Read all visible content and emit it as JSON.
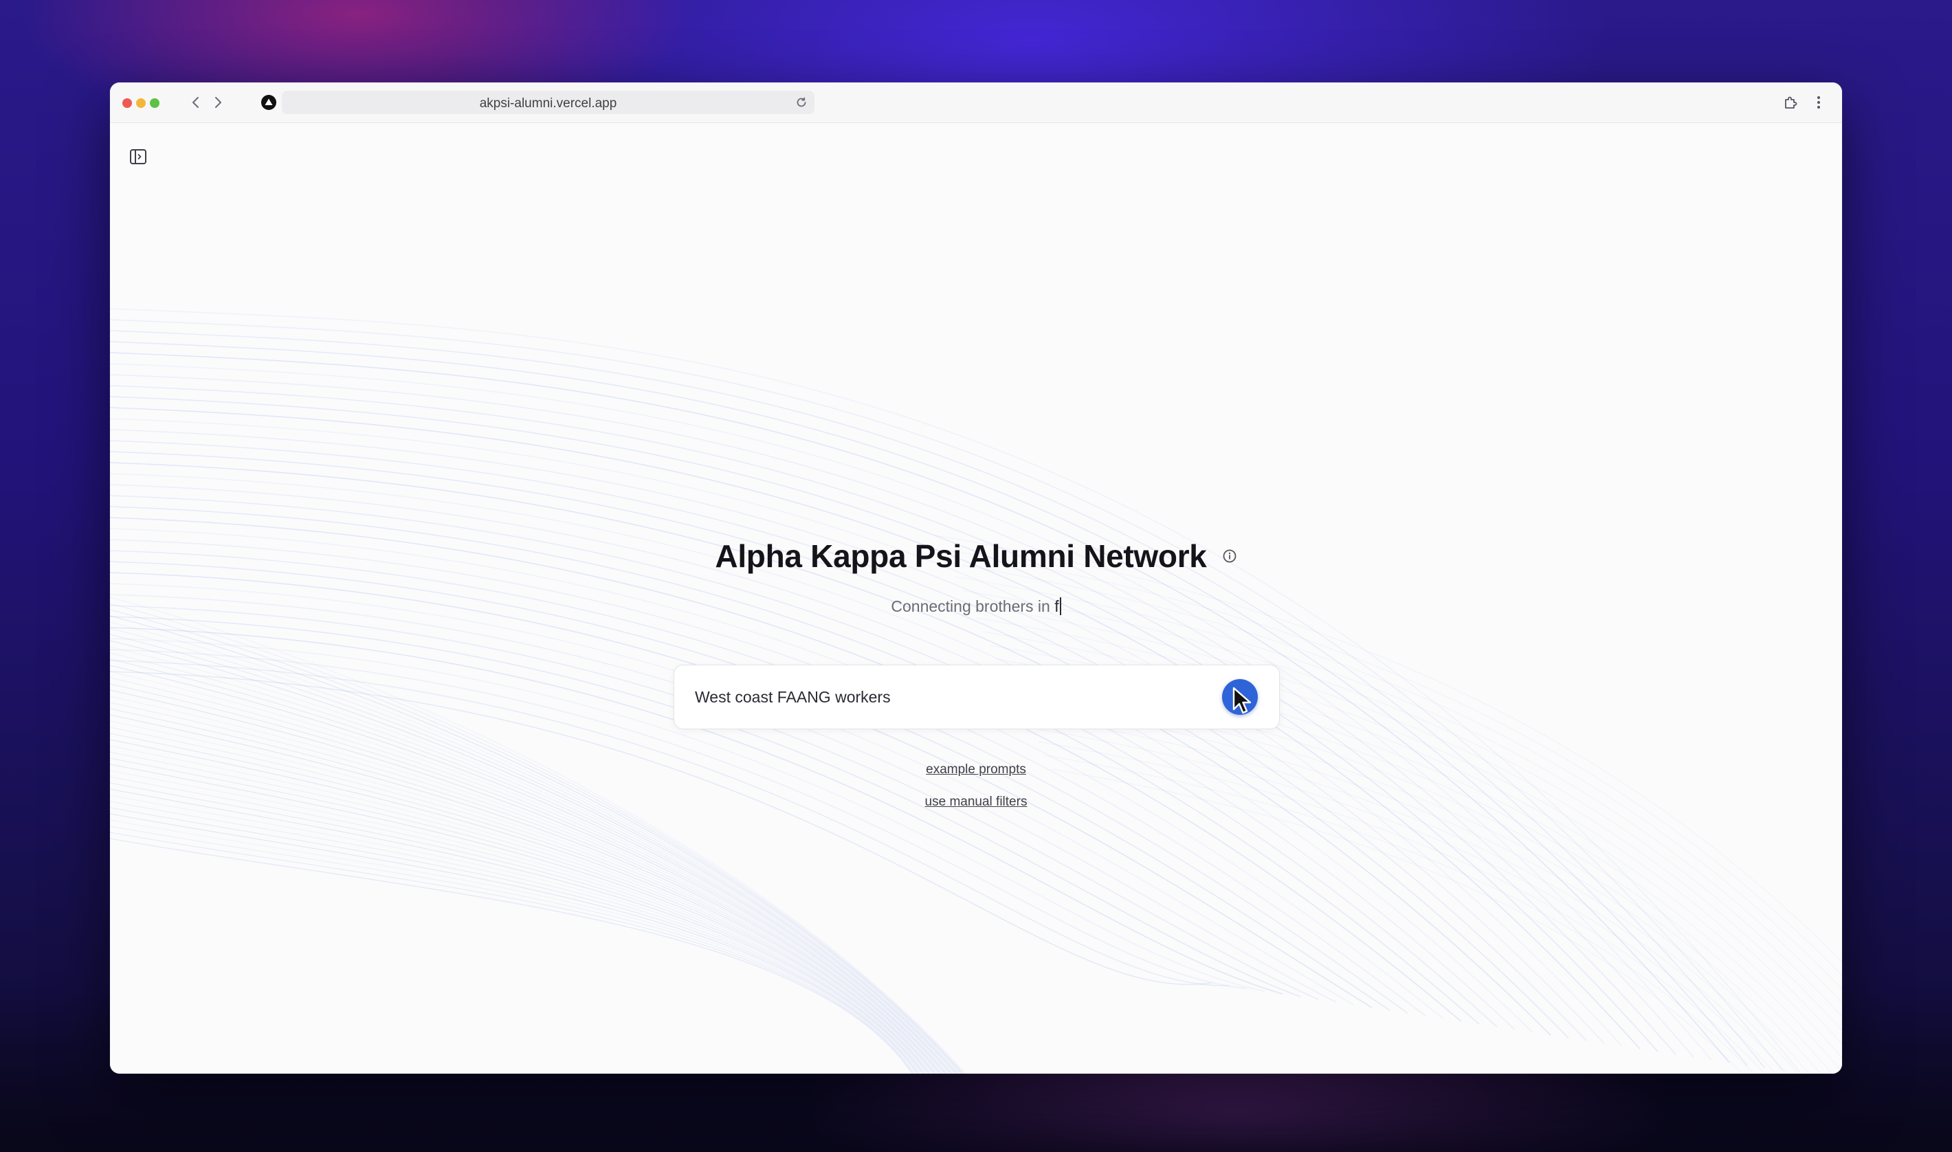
{
  "browser": {
    "url": "akpsi-alumni.vercel.app",
    "icons": {
      "back": "chevron-left-icon",
      "forward": "chevron-right-icon",
      "site": "vercel-icon",
      "reload": "reload-icon",
      "extensions": "puzzle-piece-icon",
      "menu": "vertical-dots-icon"
    }
  },
  "page": {
    "sidebar_toggle_icon": "sidebar-panel-icon",
    "title": "Alpha Kappa Psi Alumni Network",
    "title_info_icon": "info-icon",
    "subtitle_prefix": "Connecting brothers in ",
    "subtitle_typed": "f",
    "search": {
      "value": "West coast FAANG workers",
      "submit_icon": "arrow-submit-icon"
    },
    "links": {
      "example_prompts": "example prompts",
      "manual_filters": "use manual filters"
    }
  },
  "colors": {
    "accent": "#2f63d8",
    "title": "#14141a",
    "subtitle": "#6b6b74",
    "wave_lines": "#9fb3e6"
  }
}
